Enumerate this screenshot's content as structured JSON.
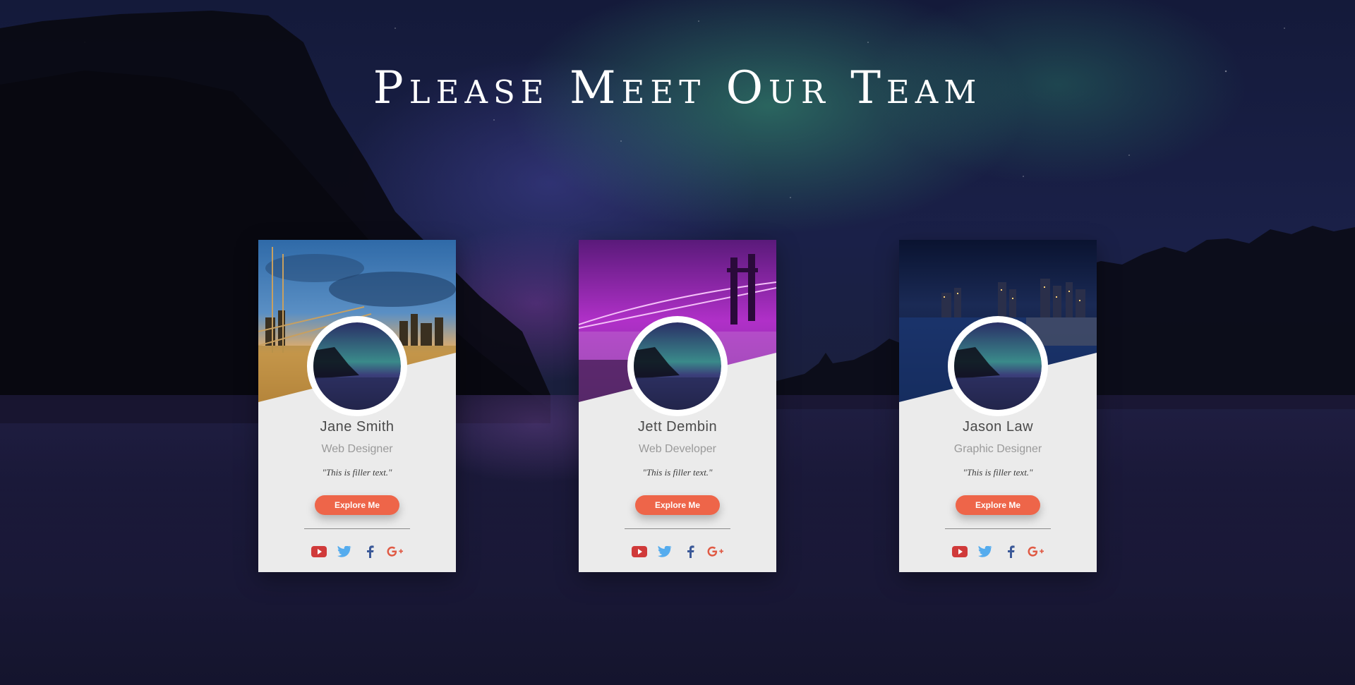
{
  "page": {
    "title": "Please Meet Our Team"
  },
  "colors": {
    "accent_button": "#ee6549",
    "card_background": "#ebebeb",
    "youtube": "#d03a3a",
    "twitter": "#55acee",
    "facebook": "#3b5998",
    "google_plus": "#e05a44"
  },
  "team": [
    {
      "name": "Jane Smith",
      "role": "Web Designer",
      "quote": "\"This is filler text.\"",
      "button_label": "Explore Me",
      "cover_theme": "city-sunset"
    },
    {
      "name": "Jett Dembin",
      "role": "Web Developer",
      "quote": "\"This is filler text.\"",
      "button_label": "Explore Me",
      "cover_theme": "bridge-purple"
    },
    {
      "name": "Jason Law",
      "role": "Graphic Designer",
      "quote": "\"This is filler text.\"",
      "button_label": "Explore Me",
      "cover_theme": "city-night"
    }
  ],
  "social_icons": [
    "youtube-icon",
    "twitter-icon",
    "facebook-icon",
    "google-plus-icon"
  ]
}
